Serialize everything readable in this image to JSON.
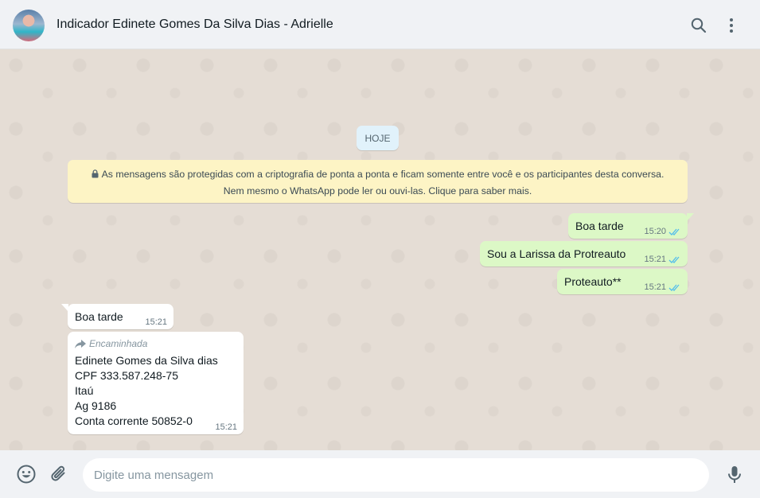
{
  "header": {
    "contact_name": "Indicador Edinete Gomes Da Silva Dias - Adrielle",
    "icons": [
      "search-icon",
      "menu-icon"
    ]
  },
  "chat": {
    "day_label": "HOJE",
    "encryption_notice": {
      "line1": "As mensagens são protegidas com a criptografia de ponta a ponta e ficam somente entre você e os participantes desta conversa.",
      "line2": "Nem mesmo o WhatsApp pode ler ou ouvi-las. Clique para saber mais."
    },
    "messages": [
      {
        "direction": "out",
        "text": "Boa tarde",
        "time": "15:20",
        "status": "read"
      },
      {
        "direction": "out",
        "text": "Sou a Larissa da Protreauto",
        "time": "15:21",
        "status": "read"
      },
      {
        "direction": "out",
        "text": "Proteauto**",
        "time": "15:21",
        "status": "read"
      },
      {
        "direction": "in",
        "text": "Boa tarde",
        "time": "15:21"
      },
      {
        "direction": "in",
        "forwarded_label": "Encaminhada",
        "lines": [
          "Edinete Gomes da Silva dias",
          "CPF 333.587.248-75",
          "Itaú",
          "Ag 9186",
          "Conta corrente 50852-0"
        ],
        "time": "15:21"
      }
    ]
  },
  "composer": {
    "placeholder": "Digite uma mensagem",
    "value": "",
    "icons": [
      "emoji-icon",
      "attach-icon",
      "microphone-icon"
    ]
  },
  "colors": {
    "outgoing_bubble": "#dcf8c6",
    "incoming_bubble": "#ffffff",
    "read_ticks": "#53bdeb",
    "encryption_banner": "#fdf4c5"
  }
}
